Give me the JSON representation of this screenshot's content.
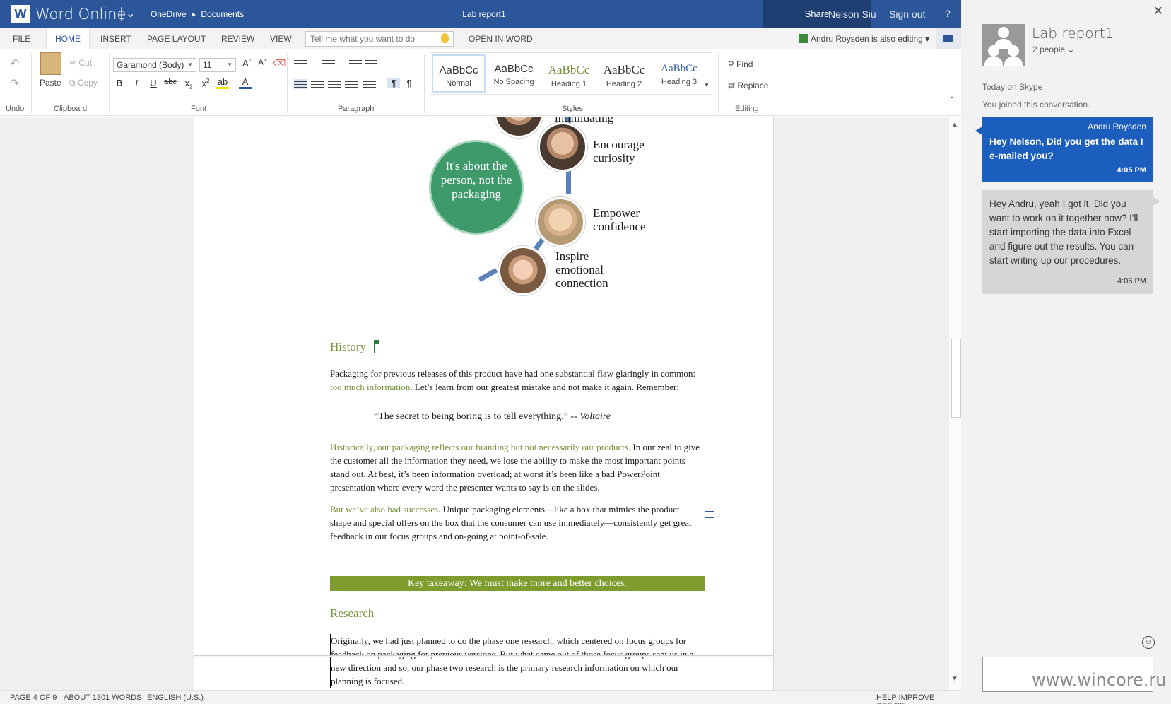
{
  "titlebar": {
    "app_name": "Word Online",
    "breadcrumb": [
      "OneDrive",
      "Documents"
    ],
    "doc_title": "Lab report1",
    "share": "Share",
    "user": "Nelson Siu",
    "sign_out": "Sign out",
    "help": "?"
  },
  "tabs": [
    "FILE",
    "HOME",
    "INSERT",
    "PAGE LAYOUT",
    "REVIEW",
    "VIEW"
  ],
  "active_tab": "HOME",
  "tell_me_placeholder": "Tell me what you want to do",
  "open_in_word": "OPEN IN WORD",
  "also_editing": "Andru Roysden is also editing",
  "ribbon": {
    "groups": {
      "undo": "Undo",
      "clipboard": "Clipboard",
      "font": "Font",
      "paragraph": "Paragraph",
      "styles": "Styles",
      "editing": "Editing"
    },
    "paste": "Paste",
    "cut": "Cut",
    "copy": "Copy",
    "font_name": "Garamond (Body)",
    "font_size": "11",
    "styles": [
      {
        "sample": "AaBbCc",
        "name": "Normal",
        "color": "#1a1a1a"
      },
      {
        "sample": "AaBbCc",
        "name": "No Spacing",
        "color": "#1a1a1a"
      },
      {
        "sample": "AaBbCc",
        "name": "Heading 1",
        "color": "#76923c"
      },
      {
        "sample": "AaBbCc",
        "name": "Heading 2",
        "color": "#1a1a1a"
      },
      {
        "sample": "AaBbCc",
        "name": "Heading 3",
        "color": "#2b579a"
      }
    ],
    "find": "Find",
    "replace": "Replace"
  },
  "document": {
    "infographic": {
      "top_label": "intimidating",
      "center": "It's about the person, not the packaging",
      "items": [
        "Encourage curiosity",
        "Empower confidence",
        "Inspire emotional connection"
      ]
    },
    "history_heading": "History",
    "p1_a": "Packaging for previous releases of this product have had one substantial flaw glaringly in common: ",
    "p1_link": "too much information",
    "p1_b": ". Let’s learn from our greatest mistake and not make it again. Remember:",
    "quote": "“The secret to being boring is to tell everything.” -- ",
    "quote_author": "Voltaire",
    "p2_link": "Historically, our packaging reflects our branding but not necessarily our products",
    "p2_b": ". In our zeal to give the customer all the information they need, we lose the ability to make the most important points stand out. At best, it’s been information overload; at worst it’s been like a bad PowerPoint presentation where every word the presenter wants to say is on the slides.",
    "p3_link": "But we’ve also had successes",
    "p3_b": ". Unique packaging elements—like a box that mimics the product shape and special offers on the box that the consumer can use immediately—consistently get great feedback in our focus groups and on-going at point-of-sale.",
    "takeaway": "Key takeaway: We must make more and better choices.",
    "research_heading": "Research",
    "p4": "Originally, we had just planned to do the phase one research, which centered on focus groups for feedback on packaging for previous versions. But what came out of those focus groups sent us in a new direction and so, our phase two research is the primary research information on which our planning is focused."
  },
  "status": {
    "page": "PAGE 4 OF 9",
    "words": "ABOUT 1301 WORDS",
    "language": "ENGLISH (U.S.)",
    "help": "HELP IMPROVE OFFICE"
  },
  "skype": {
    "title": "Lab report1",
    "people": "2 people",
    "today": "Today on Skype",
    "joined": "You joined this conversation.",
    "messages": [
      {
        "sender": "Andru Roysden",
        "text": "Hey Nelson, Did you get the data I e-mailed you?",
        "time": "4:05 PM"
      },
      {
        "text": "Hey Andru, yeah I got it. Did you want to work on it together now? I'll start importing the data into Excel and figure out the results. You can start writing up our procedures.",
        "time": "4:06 PM"
      }
    ],
    "watermark": "www.wincore.ru"
  }
}
